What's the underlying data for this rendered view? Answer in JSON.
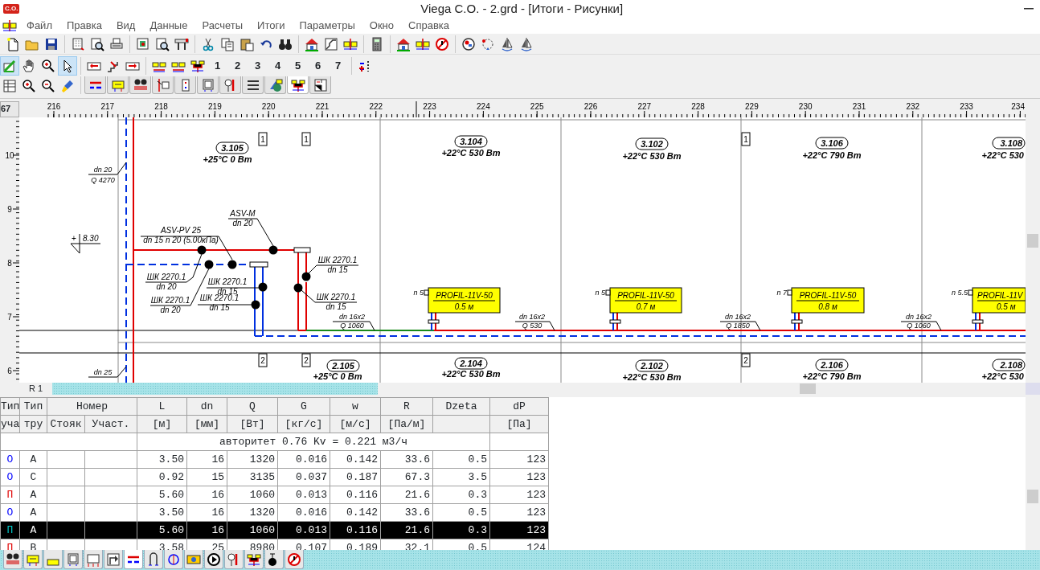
{
  "window": {
    "app_badge": "C.O.",
    "title": "Viega C.O. - 2.grd - [Итоги - Рисунки]"
  },
  "menu": [
    "Файл",
    "Правка",
    "Вид",
    "Данные",
    "Расчеты",
    "Итоги",
    "Параметры",
    "Окно",
    "Справка"
  ],
  "mode_tools": [
    {
      "selected": true
    },
    {
      "selected": false
    },
    {
      "selected": false
    },
    {
      "selected": true
    }
  ],
  "toolbar_numbers": [
    "1",
    "2",
    "3",
    "4",
    "5",
    "6",
    "7"
  ],
  "view_tabs": [
    {
      "selected": false
    },
    {
      "selected": false
    },
    {
      "selected": false
    },
    {
      "selected": false
    },
    {
      "selected": false
    },
    {
      "selected": false
    },
    {
      "selected": false
    },
    {
      "selected": false
    },
    {
      "selected": false
    },
    {
      "selected": true
    },
    {
      "selected": false
    }
  ],
  "ruler": {
    "corner": "67",
    "x_labels": [
      "216",
      "217",
      "218",
      "219",
      "220",
      "221",
      "222",
      "223",
      "224",
      "225",
      "226",
      "227",
      "228",
      "229",
      "230",
      "231",
      "232",
      "233",
      "234"
    ],
    "y_labels": [
      "10",
      "9",
      "8",
      "7",
      "6"
    ]
  },
  "drawing": {
    "rooms_upper": [
      {
        "number": "3.105",
        "info": "+25°C 0 Вт"
      },
      {
        "number": "3.104",
        "info": "+22°C 530 Вт"
      },
      {
        "number": "3.102",
        "info": "+22°C 530 Вт"
      },
      {
        "number": "3.106",
        "info": "+22°C 790 Вт"
      },
      {
        "number": "3.108",
        "info": "+22°C 530"
      }
    ],
    "rooms_lower": [
      {
        "number": "2.105",
        "info": "+25°C 0 Вт"
      },
      {
        "number": "2.104",
        "info": "+22°C 530 Вт"
      },
      {
        "number": "2.102",
        "info": "+22°C 530 Вт"
      },
      {
        "number": "2.106",
        "info": "+22°C 790 Вт"
      },
      {
        "number": "2.108",
        "info": "+22°C 530"
      }
    ],
    "riser_marks": [
      "1",
      "1",
      "1",
      "2",
      "2",
      "2"
    ],
    "level_mark": {
      "sign": "+",
      "value": "8.30"
    },
    "fittings": [
      {
        "name": "ASV-PV 25",
        "size": "dn 15  n 20 (5.00кПа)"
      },
      {
        "name": "ASV-M",
        "size": "dn 20"
      },
      {
        "name": "ШК 2270.1",
        "size": "dn 20"
      },
      {
        "name": "ШК 2270.1",
        "size": "dn 20"
      },
      {
        "name": "ШК 2270.1",
        "size": "dn 15"
      },
      {
        "name": "ШК 2270.1",
        "size": "dn 15"
      },
      {
        "name": "ШК 2270.1",
        "size": "dn 15"
      },
      {
        "name": "ШК 2270.1",
        "size": "dn 15"
      }
    ],
    "pipe_labels": [
      {
        "dn": "dn 20",
        "q": "Q 4270"
      },
      {
        "dn": "dn 25"
      },
      {
        "dn": "dn 16x2",
        "q": "Q 1060"
      },
      {
        "dn": "dn 16x2",
        "q": "Q 530"
      },
      {
        "dn": "dn 16x2",
        "q": "Q 1850"
      },
      {
        "dn": "dn 16x2",
        "q": "Q 1060"
      }
    ],
    "radiators": [
      {
        "model": "PROFIL-11V-50",
        "length": "0.5 м",
        "setting": "n 5"
      },
      {
        "model": "PROFIL-11V-50",
        "length": "0.7 м",
        "setting": "n 5"
      },
      {
        "model": "PROFIL-11V-50",
        "length": "0.8 м",
        "setting": "n 7"
      },
      {
        "model": "PROFIL-11V",
        "length": "0.5 м",
        "setting": "n 5.5"
      }
    ],
    "sheet_tab": "R 1"
  },
  "table": {
    "header_top": [
      "Тип",
      "Тип",
      "Номер",
      "L",
      "dn",
      "Q",
      "G",
      "w",
      "R",
      "Dzeta",
      "dP"
    ],
    "header_bottom": [
      "уча",
      "тру",
      "Стояк",
      "Участ.",
      "[м]",
      "[мм]",
      "[Вт]",
      "[кг/с]",
      "[м/с]",
      "[Па/м]",
      "[Па]"
    ],
    "info": "авторитет  0.76    Kv =   0.221 м3/ч",
    "rows": [
      {
        "kind": "return",
        "type": "О",
        "pipe": "А",
        "L": "3.50",
        "dn": "16",
        "Q": "1320",
        "G": "0.016",
        "w": "0.142",
        "R": "33.6",
        "dzeta": "0.5",
        "dP": "123",
        "selected": false
      },
      {
        "kind": "return",
        "type": "О",
        "pipe": "С",
        "L": "0.92",
        "dn": "15",
        "Q": "3135",
        "G": "0.037",
        "w": "0.187",
        "R": "67.3",
        "dzeta": "3.5",
        "dP": "123",
        "selected": false
      },
      {
        "kind": "supply",
        "type": "П",
        "pipe": "А",
        "L": "5.60",
        "dn": "16",
        "Q": "1060",
        "G": "0.013",
        "w": "0.116",
        "R": "21.6",
        "dzeta": "0.3",
        "dP": "123",
        "selected": false
      },
      {
        "kind": "return",
        "type": "О",
        "pipe": "А",
        "L": "3.50",
        "dn": "16",
        "Q": "1320",
        "G": "0.016",
        "w": "0.142",
        "R": "33.6",
        "dzeta": "0.5",
        "dP": "123",
        "selected": false
      },
      {
        "kind": "supply",
        "type": "П",
        "pipe": "А",
        "L": "5.60",
        "dn": "16",
        "Q": "1060",
        "G": "0.013",
        "w": "0.116",
        "R": "21.6",
        "dzeta": "0.3",
        "dP": "123",
        "selected": true
      },
      {
        "kind": "supply",
        "type": "П",
        "pipe": "В",
        "L": "3.58",
        "dn": "25",
        "Q": "8980",
        "G": "0.107",
        "w": "0.189",
        "R": "32.1",
        "dzeta": "0.5",
        "dP": "124",
        "selected": false
      }
    ]
  },
  "bottom_tabs": [
    {
      "selected": false
    },
    {
      "selected": false
    },
    {
      "selected": false
    },
    {
      "selected": false
    },
    {
      "selected": false
    },
    {
      "selected": false
    },
    {
      "selected": true
    },
    {
      "selected": false
    },
    {
      "selected": false
    },
    {
      "selected": false
    },
    {
      "selected": false
    },
    {
      "selected": false
    },
    {
      "selected": false
    },
    {
      "selected": false
    },
    {
      "selected": false
    }
  ]
}
